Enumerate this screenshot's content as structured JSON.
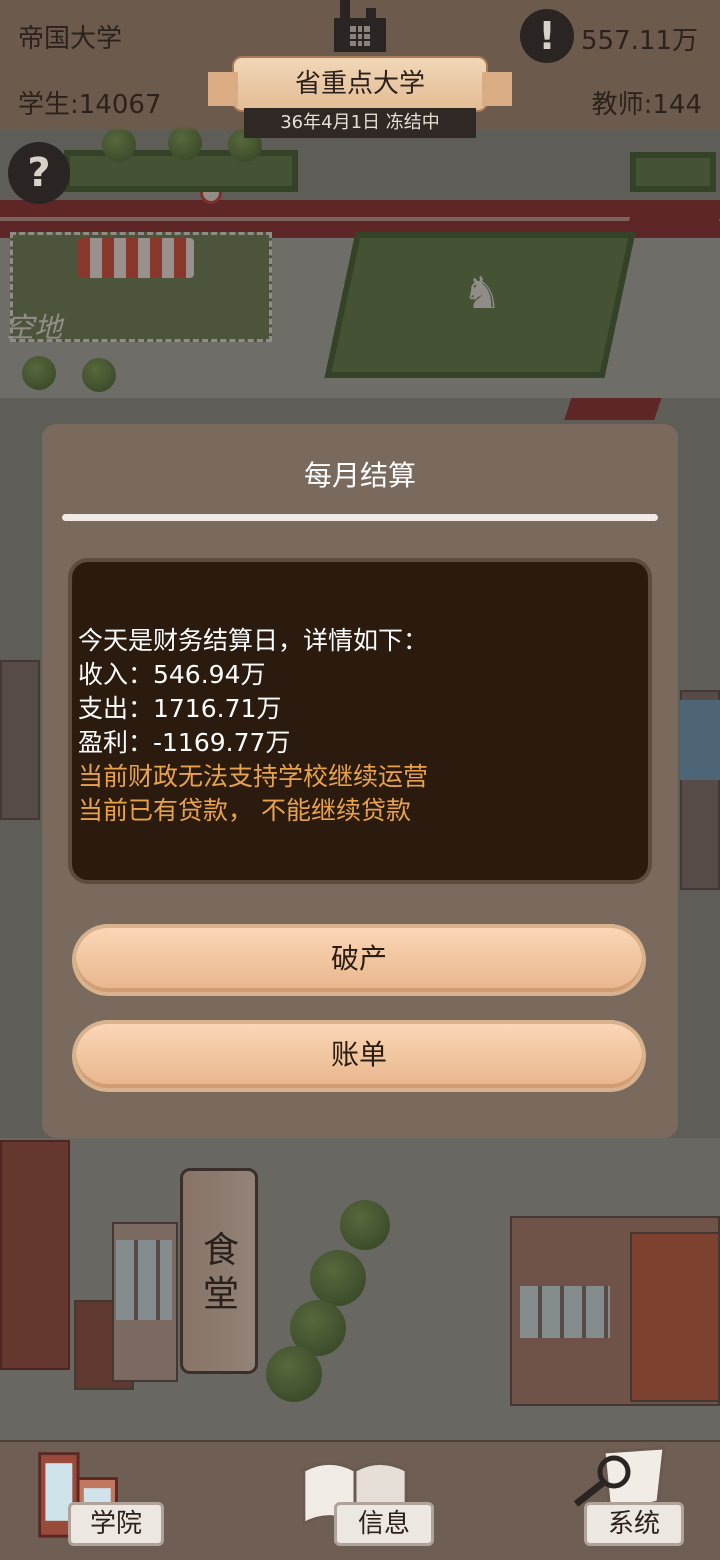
{
  "hud": {
    "school_name": "帝国大学",
    "money": "557.11万",
    "students": "学生:14067",
    "teachers": "教师:144",
    "rank": "省重点大学",
    "date_status": "36年4月1日 冻结中",
    "help_glyph": "?",
    "alert_glyph": "!"
  },
  "map": {
    "empty_lot_label": "空地",
    "canteen_label": "食堂"
  },
  "modal": {
    "title": "每月结算",
    "lines": [
      {
        "text": "今天是财务结算日，详情如下：",
        "color": "#ffffff"
      },
      {
        "text": "收入：546.94万",
        "color": "#ffffff"
      },
      {
        "text": "支出：1716.71万",
        "color": "#ffffff"
      },
      {
        "text": "盈利：-1169.77万",
        "color": "#ffffff"
      },
      {
        "text": "当前财政无法支持学校继续运营",
        "color": "#e7a24a"
      },
      {
        "text": "当前已有贷款， 不能继续贷款",
        "color": "#e7a24a"
      }
    ],
    "bankrupt_label": "破产",
    "bill_label": "账单"
  },
  "nav": {
    "college": "学院",
    "info": "信息",
    "system": "系统"
  },
  "icons": {
    "help": "question-icon",
    "alert": "exclamation-icon",
    "factory": "factory-icon",
    "college": "building-icon",
    "info": "book-icon",
    "system": "magnifier-map-icon"
  },
  "colors": {
    "modal_bg": "#7a6a5d",
    "report_bg": "#2b1b0e",
    "warning_text": "#e7a24a",
    "button_fill": "#efc39c"
  }
}
